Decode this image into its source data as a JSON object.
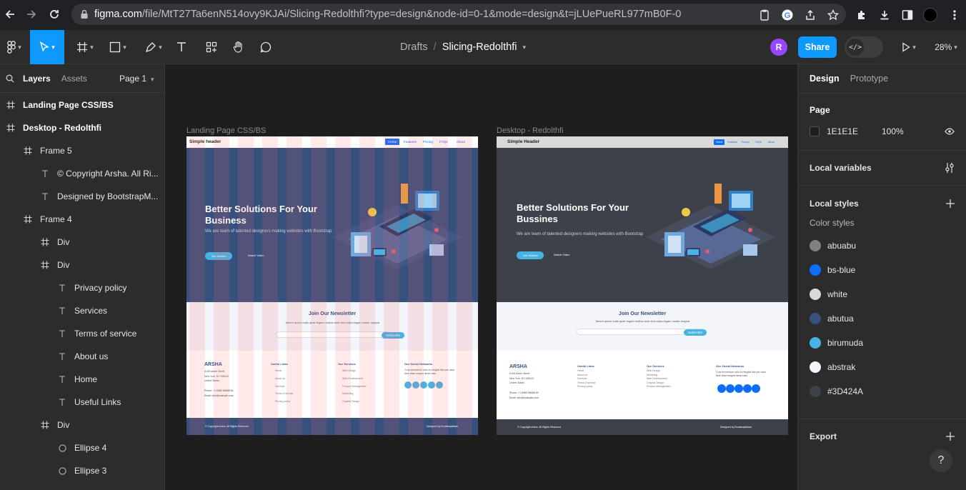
{
  "browser": {
    "url_host": "figma.com",
    "url_path": "/file/MtT27Ta6enN514ovy9KJAi/Slicing-Redolthfi?type=design&node-id=0-1&mode=design&t=jLUePueRL977mB0F-0"
  },
  "toolbar": {
    "breadcrumb_root": "Drafts",
    "breadcrumb_sep": "/",
    "file_name": "Slicing-Redolthfi",
    "avatar_letter": "R",
    "share_label": "Share",
    "zoom": "28%",
    "colors": {
      "accent": "#0d99ff",
      "avatar": "#9747ff"
    }
  },
  "left_panel": {
    "tabs": {
      "layers": "Layers",
      "assets": "Assets",
      "page": "Page 1"
    },
    "layers": [
      {
        "label": "Landing Page CSS/BS",
        "icon": "frame-icon",
        "indent": 0
      },
      {
        "label": "Desktop - Redolthfi",
        "icon": "frame-icon",
        "indent": 0
      },
      {
        "label": "Frame 5",
        "icon": "frame-icon",
        "indent": 1
      },
      {
        "label": "© Copyright Arsha. All Ri...",
        "icon": "text-icon",
        "indent": 2
      },
      {
        "label": "Designed by BootstrapM...",
        "icon": "text-icon",
        "indent": 2
      },
      {
        "label": "Frame 4",
        "icon": "frame-icon",
        "indent": 1
      },
      {
        "label": "Div",
        "icon": "frame-icon",
        "indent": 2
      },
      {
        "label": "Div",
        "icon": "frame-icon",
        "indent": 2
      },
      {
        "label": "Privacy policy",
        "icon": "text-icon",
        "indent": 3
      },
      {
        "label": "Services",
        "icon": "text-icon",
        "indent": 3
      },
      {
        "label": "Terms of service",
        "icon": "text-icon",
        "indent": 3
      },
      {
        "label": "About us",
        "icon": "text-icon",
        "indent": 3
      },
      {
        "label": "Home",
        "icon": "text-icon",
        "indent": 3
      },
      {
        "label": "Useful Links",
        "icon": "text-icon",
        "indent": 3
      },
      {
        "label": "Div",
        "icon": "frame-icon",
        "indent": 2
      },
      {
        "label": "Ellipse 4",
        "icon": "ellipse-icon",
        "indent": 3
      },
      {
        "label": "Ellipse 3",
        "icon": "ellipse-icon",
        "indent": 3
      }
    ]
  },
  "right_panel": {
    "tabs": {
      "design": "Design",
      "prototype": "Prototype"
    },
    "page": {
      "title": "Page",
      "color": "1E1E1E",
      "opacity": "100%"
    },
    "local_variables": "Local variables",
    "local_styles": "Local styles",
    "color_styles_title": "Color styles",
    "color_styles": [
      {
        "name": "abuabu",
        "color": "#808080"
      },
      {
        "name": "bs-blue",
        "color": "#0d6efd"
      },
      {
        "name": "white",
        "color": "#d9d9d9"
      },
      {
        "name": "abutua",
        "color": "#37517e"
      },
      {
        "name": "birumuda",
        "color": "#47b2e4"
      },
      {
        "name": "abstrak",
        "color": "#f3f5fa"
      },
      {
        "name": "#3D424A",
        "color": "#3d424a"
      }
    ],
    "export": "Export",
    "help": "?"
  },
  "canvas": {
    "frame1": {
      "label": "Landing Page CSS/BS",
      "header": "Simple header",
      "nav": [
        "Home",
        "Features",
        "Pricing",
        "FAQs",
        "About"
      ],
      "hero_title": "Better Solutions For Your Business",
      "hero_sub": "We are team of talented designers making websites with Bootstrap",
      "btn_primary": "Get Started",
      "btn_secondary": "Watch Video",
      "newsletter_title": "Join Our Newsletter",
      "newsletter_sub": "Tamen quem nulla quae legam multos aute sint culpa legam noster magna",
      "subscribe": "Subscribe",
      "brand": "ARSHA",
      "address": [
        "A108 Adam Street",
        "New York, NY 535022",
        "United States"
      ],
      "phone": "Phone: +1 5589 55488 55",
      "email": "Email: info@example.com",
      "useful_title": "Useful Links",
      "useful": [
        "Home",
        "About us",
        "Services",
        "Terms of service",
        "Privacy policy"
      ],
      "services_title": "Our Services",
      "services": [
        "Web Design",
        "Web Development",
        "Product Management",
        "Marketing",
        "Graphic Design"
      ],
      "social_title": "Our Social Networks",
      "social_text": "Cras fermentum odio eu feugiat lide par naso tiere vitae magna derra caso",
      "copyright": "© Copyright Arsha. All Rights Reserved",
      "designed": "Designed by BootstrapMade"
    },
    "frame2": {
      "label": "Desktop - Redolthfi",
      "header": "Simple Header",
      "nav": [
        "Home",
        "Features",
        "Pricing",
        "FAQs",
        "About"
      ],
      "hero_title": "Better Solutions For Your Bussines",
      "hero_sub": "We are team of talented designers making websites with Bootstrap",
      "btn_primary": "Get Started",
      "btn_secondary": "Watch Video",
      "newsletter_title": "Join Our Newsletter",
      "newsletter_sub": "Tamen quem nulla quae legam multos aute sint culpa legam noster magna",
      "subscribe": "Subscribe",
      "brand": "ARSHA",
      "address": [
        "A108 Adam Street",
        "New York, NY 535022",
        "United States"
      ],
      "phone": "Phone: +1 5589 55488 55",
      "email": "Email: info@example.com",
      "useful_title": "Useful Links",
      "useful": [
        "Home",
        "About us",
        "Services",
        "Terms of service",
        "Privacy policy"
      ],
      "services_title": "Our Services",
      "services": [
        "Web Design",
        "Marketing",
        "Web Development",
        "Graphic Design",
        "Product Management"
      ],
      "social_title": "Our Social Networks",
      "social_text": "Cras fermentum odio eu feugiat lide par naso tiere vitae magna derra caso",
      "copyright": "© Copyright Arsha. All Rights Reserved",
      "designed": "Designed by BootstrapMade"
    }
  }
}
